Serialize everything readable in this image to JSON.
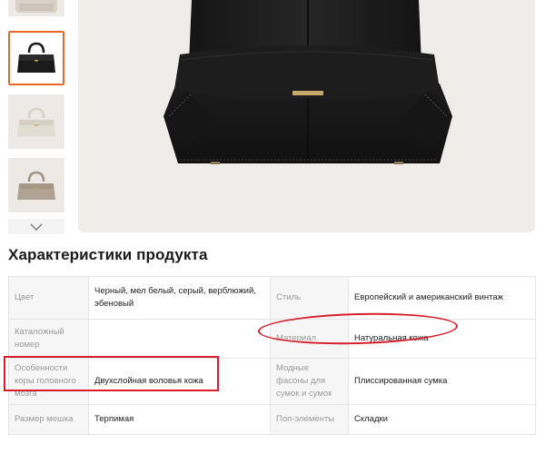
{
  "gallery": {
    "thumbnails": [
      {
        "color": "#e6e2dc",
        "bag_color": "#d9d3ca",
        "name": "thumbnail-partial"
      },
      {
        "color": "#ffffff",
        "bag_color": "#1b1b1b",
        "name": "thumbnail-black"
      },
      {
        "color": "#ece9e4",
        "bag_color": "#e2ddd2",
        "name": "thumbnail-white"
      },
      {
        "color": "#ece9e4",
        "bag_color": "#b1a393",
        "name": "thumbnail-taupe"
      }
    ],
    "active_index": 1,
    "down_arrow_icon": "chevron-down-icon"
  },
  "section": {
    "title": "Характеристики продукта"
  },
  "specs": {
    "rows": [
      {
        "left_label": "Цвет",
        "left_value": "Черный, мел белый, серый, верблюжий, эбеновый",
        "right_label": "Стиль",
        "right_value": "Европейский и американский винтаж"
      },
      {
        "left_label": "Каталожный номер",
        "left_value": "",
        "right_label": "Материал",
        "right_value": "Натуральная кожа"
      },
      {
        "left_label": "Особенности коры головного мозга",
        "left_value": "Двухслойная воловья кожа",
        "right_label": "Модные фасоны для сумок и сумок",
        "right_value": "Плиссированная сумка"
      },
      {
        "left_label": "Размер мешка",
        "left_value": "Терпимая",
        "right_label": "Поп-элементы",
        "right_value": "Складки"
      }
    ]
  },
  "colors": {
    "accent": "#e8672e",
    "annotation": "#d61f2c",
    "label_bg": "#f6f6f6",
    "label_text": "#9a9a9a"
  }
}
